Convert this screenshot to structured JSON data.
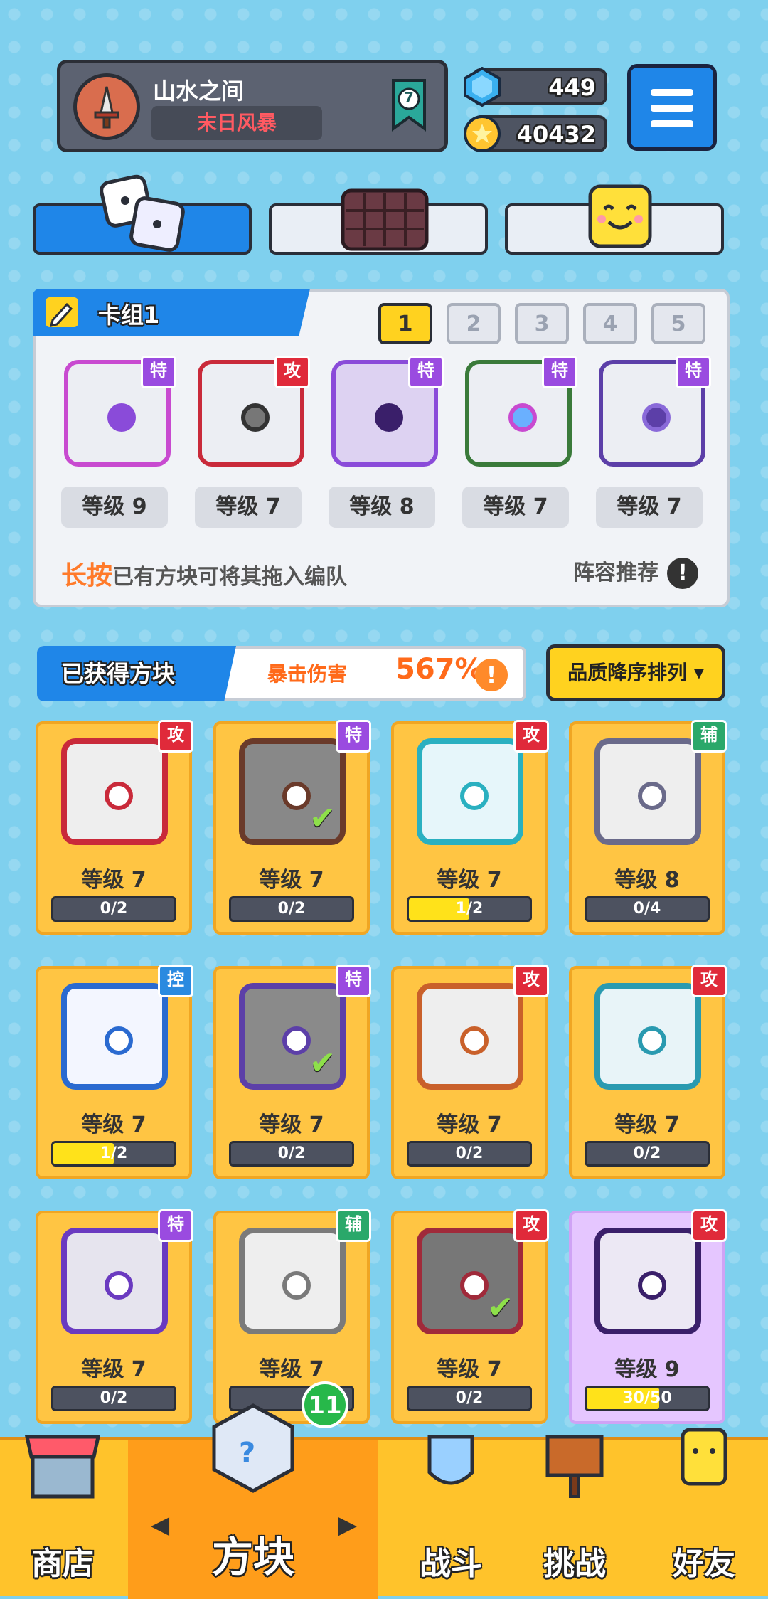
{
  "header": {
    "player_name": "山水之间",
    "player_title": "末日风暴",
    "rank_level": "7",
    "gems": "449",
    "coins": "40432"
  },
  "mode_tabs": [
    "dice-tab",
    "board-tab",
    "emoji-tab"
  ],
  "deck": {
    "title": "卡组1",
    "tabs": [
      "1",
      "2",
      "3",
      "4",
      "5"
    ],
    "selected_tab": "1",
    "cards": [
      {
        "badge": "特",
        "level": "等级 9",
        "color": "#8a4bd9"
      },
      {
        "badge": "攻",
        "level": "等级 7",
        "color": "#c92a3a"
      },
      {
        "badge": "特",
        "level": "等级 8",
        "color": "#8a4bd9"
      },
      {
        "badge": "特",
        "level": "等级 7",
        "color": "#3a7a3a"
      },
      {
        "badge": "特",
        "level": "等级 7",
        "color": "#5c3fa8"
      }
    ],
    "hint_emph": "长按",
    "hint_rest": "已有方块可将其拖入编队",
    "recommend": "阵容推荐",
    "exclamation": "!"
  },
  "owned": {
    "label": "已获得方块",
    "crit_label": "暴击伤害",
    "crit_value": "567%",
    "sort_label": "品质降序排列 ▾"
  },
  "grid": [
    {
      "badge": "攻",
      "badge_color": "#e02a3a",
      "level": "等级 7",
      "progress": "0/2",
      "fill": 0,
      "frame": "#c92a3a",
      "check": false,
      "tint": "#eee"
    },
    {
      "badge": "特",
      "badge_color": "#9a4be0",
      "level": "等级 7",
      "progress": "0/2",
      "fill": 0,
      "frame": "#6a3a2a",
      "check": true,
      "tint": "#888"
    },
    {
      "badge": "攻",
      "badge_color": "#e02a3a",
      "level": "等级 7",
      "progress": "1/2",
      "fill": 0.5,
      "frame": "#2ab0c0",
      "check": false,
      "tint": "#e6f6fa"
    },
    {
      "badge": "辅",
      "badge_color": "#2aa86a",
      "level": "等级 8",
      "progress": "0/4",
      "fill": 0,
      "frame": "#6a6a8a",
      "check": false,
      "tint": "#eee"
    },
    {
      "badge": "控",
      "badge_color": "#2a8ae0",
      "level": "等级 7",
      "progress": "1/2",
      "fill": 0.5,
      "frame": "#2a6ad0",
      "check": false,
      "tint": "#f3f6ff"
    },
    {
      "badge": "特",
      "badge_color": "#9a4be0",
      "level": "等级 7",
      "progress": "0/2",
      "fill": 0,
      "frame": "#5c3fa8",
      "check": true,
      "tint": "#8a8a8a"
    },
    {
      "badge": "攻",
      "badge_color": "#e02a3a",
      "level": "等级 7",
      "progress": "0/2",
      "fill": 0,
      "frame": "#c9602a",
      "check": false,
      "tint": "#eee"
    },
    {
      "badge": "攻",
      "badge_color": "#e02a3a",
      "level": "等级 7",
      "progress": "0/2",
      "fill": 0,
      "frame": "#2a9ab0",
      "check": false,
      "tint": "#e8f4f8"
    },
    {
      "badge": "特",
      "badge_color": "#9a4be0",
      "level": "等级 7",
      "progress": "0/2",
      "fill": 0,
      "frame": "#6a3ac0",
      "check": false,
      "tint": "#e6e4ee"
    },
    {
      "badge": "辅",
      "badge_color": "#2aa86a",
      "level": "等级 7",
      "progress": "",
      "fill": 0,
      "frame": "#7a7a7a",
      "check": false,
      "tint": "#eee"
    },
    {
      "badge": "攻",
      "badge_color": "#e02a3a",
      "level": "等级 7",
      "progress": "0/2",
      "fill": 0,
      "frame": "#a02a3a",
      "check": true,
      "tint": "#777"
    },
    {
      "badge": "攻",
      "badge_color": "#e02a3a",
      "level": "等级 9",
      "progress": "30/50",
      "fill": 0.6,
      "frame": "#3a1f6a",
      "check": false,
      "tint": "#ece8f4",
      "purple": true
    }
  ],
  "nav": {
    "shop": "商店",
    "blocks": "方块",
    "battle": "战斗",
    "challenge": "挑战",
    "friends": "好友",
    "new_count": "11",
    "prev": "◀",
    "next": "▶"
  }
}
